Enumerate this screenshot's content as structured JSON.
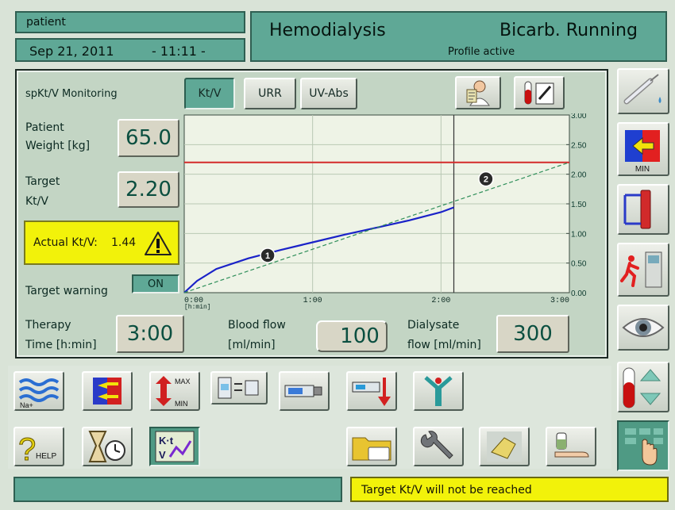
{
  "header": {
    "patient_label": "patient",
    "date": "Sep 21, 2011",
    "time": "- 11:11 -",
    "mode": "Hemodialysis",
    "status": "Bicarb. Running",
    "profile": "Profile active"
  },
  "monitor": {
    "title": "spKt/V Monitoring",
    "tabs": [
      "Kt/V",
      "URR",
      "UV-Abs"
    ],
    "active_tab": "Kt/V"
  },
  "params": {
    "weight_label_1": "Patient",
    "weight_label_2": "Weight [kg]",
    "weight_value": "65.0",
    "target_label_1": "Target",
    "target_label_2": "Kt/V",
    "target_value": "2.20",
    "actual_label": "Actual Kt/V:",
    "actual_value": "1.44",
    "warning_label": "Target warning",
    "warning_state": "ON"
  },
  "bottom_params": {
    "therapy_label_1": "Therapy",
    "therapy_label_2": "Time [h:min]",
    "therapy_value": "3:00",
    "blood_label_1": "Blood flow",
    "blood_label_2": "[ml/min]",
    "blood_value": "100",
    "dial_label_1": "Dialysate",
    "dial_label_2": "flow [ml/min]",
    "dial_value": "300"
  },
  "chart_data": {
    "type": "line",
    "x_unit_label": "[h:min]",
    "x_ticks": [
      "0:00",
      "1:00",
      "2:00",
      "3:00"
    ],
    "y_ticks": [
      "0.00",
      "0.50",
      "1.00",
      "1.50",
      "2.00",
      "2.50",
      "3.00"
    ],
    "xlim": [
      0,
      3
    ],
    "ylim": [
      0,
      3
    ],
    "target_line": 2.2,
    "current_time": 2.1,
    "series": [
      {
        "role": "actual",
        "color": "#1a22c8",
        "x": [
          0,
          0.1,
          0.25,
          0.5,
          0.75,
          1.0,
          1.25,
          1.5,
          1.75,
          2.0,
          2.1
        ],
        "y": [
          0,
          0.2,
          0.4,
          0.58,
          0.72,
          0.85,
          0.98,
          1.1,
          1.22,
          1.36,
          1.44
        ]
      },
      {
        "role": "projected",
        "color": "#2f8f5a",
        "x": [
          0,
          3.0
        ],
        "y": [
          0,
          2.2
        ]
      }
    ],
    "markers": [
      {
        "label": "1",
        "x": 0.65,
        "y": 0.63
      },
      {
        "label": "2",
        "x": 2.35,
        "y": 1.92
      }
    ]
  },
  "status_bar": {
    "left": "",
    "message": "Target Kt/V will not be reached"
  },
  "toolbar": {
    "help_label": "HELP",
    "max_label": "MAX",
    "min_label": "MIN",
    "na_label": "Na+",
    "min_badge": "MIN"
  },
  "colors": {
    "teal": "#5fa896",
    "panel": "#c3d5c4",
    "status_yellow": "#f2f20a",
    "target_red": "#d42a2a",
    "actual_blue": "#1a22c8",
    "projected_green": "#2f8f5a"
  }
}
